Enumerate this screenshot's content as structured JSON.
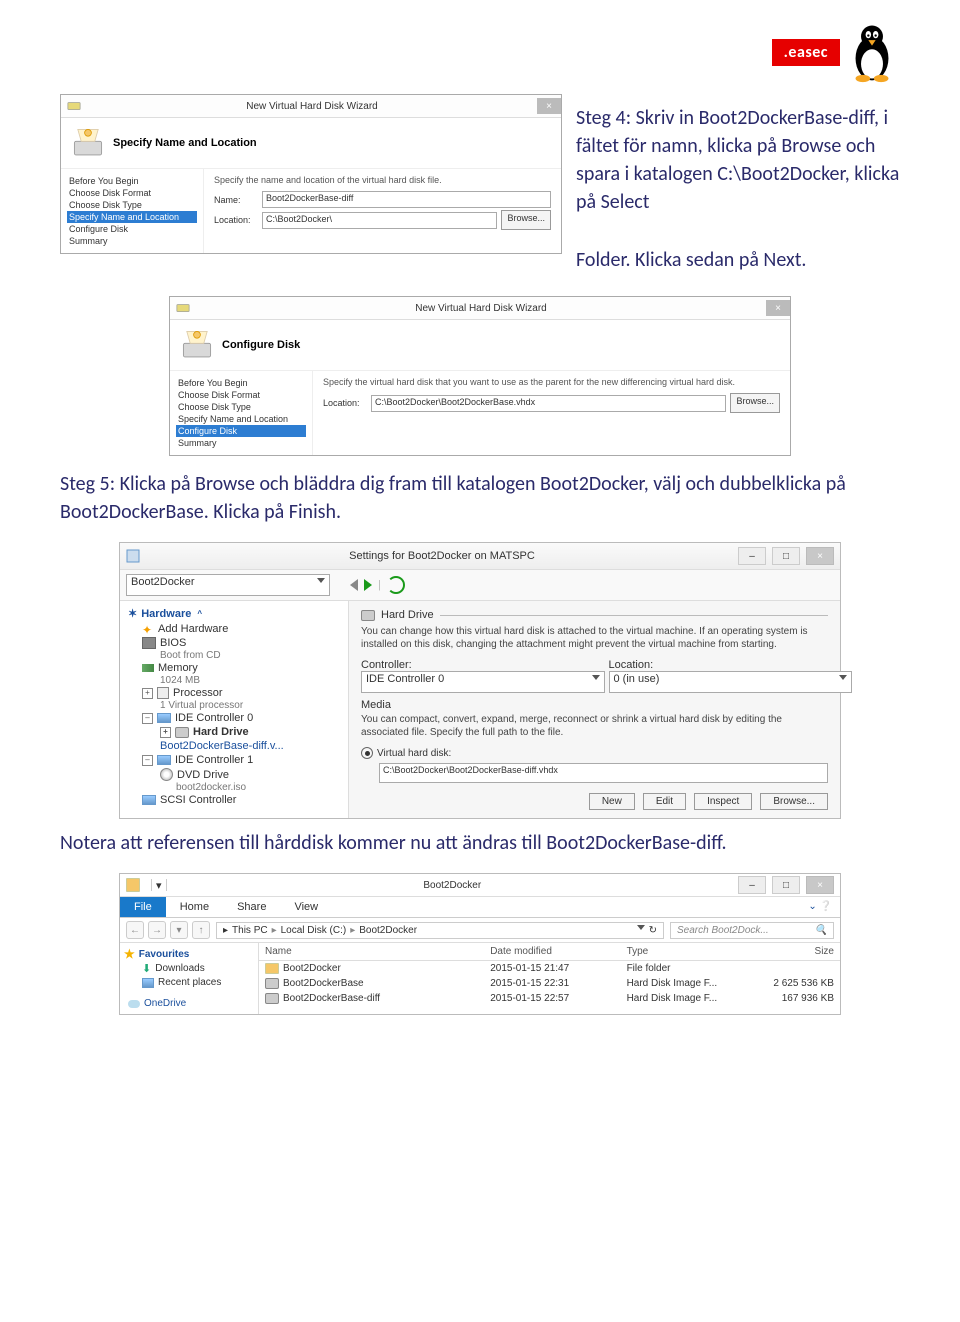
{
  "logo": {
    "brand": ".easec"
  },
  "para1": {
    "step_title": "Steg 4: Skriv in Boot2DockerBase-diff, i fältet för namn, klicka på Browse och spara i katalogen C:\\Boot2Docker, klicka på Select",
    "tail": "Folder. Klicka sedan på Next."
  },
  "wiz1": {
    "window_title": "New Virtual Hard Disk Wizard",
    "heading": "Specify Name and Location",
    "hint": "Specify the name and location of the virtual hard disk file.",
    "name_label": "Name:",
    "name_value": "Boot2DockerBase-diff",
    "loc_label": "Location:",
    "loc_value": "C:\\Boot2Docker\\",
    "browse": "Browse...",
    "steps": [
      "Before You Begin",
      "Choose Disk Format",
      "Choose Disk Type",
      "Specify Name and Location",
      "Configure Disk",
      "Summary"
    ],
    "selected_index": 3
  },
  "wiz2": {
    "window_title": "New Virtual Hard Disk Wizard",
    "heading": "Configure Disk",
    "hint": "Specify the virtual hard disk that you want to use as the parent for the new differencing virtual hard disk.",
    "loc_label": "Location:",
    "loc_value": "C:\\Boot2Docker\\Boot2DockerBase.vhdx",
    "browse": "Browse...",
    "steps": [
      "Before You Begin",
      "Choose Disk Format",
      "Choose Disk Type",
      "Specify Name and Location",
      "Configure Disk",
      "Summary"
    ],
    "selected_index": 4
  },
  "para2": "Steg 5: Klicka på Browse och bläddra dig fram till katalogen Boot2Docker, välj och dubbelklicka på Boot2DockerBase. Klicka på Finish.",
  "settings": {
    "title": "Settings for Boot2Docker on MATSPC",
    "combo": "Boot2Docker",
    "cat": "Hardware",
    "items": {
      "add_hw": "Add Hardware",
      "bios": "BIOS",
      "bios_sub": "Boot from CD",
      "memory": "Memory",
      "memory_sub": "1024 MB",
      "processor": "Processor",
      "processor_sub": "1 Virtual processor",
      "ide0": "IDE Controller 0",
      "hard_drive": "Hard Drive",
      "hd_file": "Boot2DockerBase-diff.v...",
      "ide1": "IDE Controller 1",
      "dvd": "DVD Drive",
      "dvd_file": "boot2docker.iso",
      "scsi": "SCSI Controller"
    },
    "main": {
      "group": "Hard Drive",
      "hint": "You can change how this virtual hard disk is attached to the virtual machine. If an operating system is installed on this disk, changing the attachment might prevent the virtual machine from starting.",
      "controller_label": "Controller:",
      "controller_value": "IDE Controller 0",
      "location_label": "Location:",
      "location_value": "0 (in use)",
      "media_label": "Media",
      "media_hint": "You can compact, convert, expand, merge, reconnect or shrink a virtual hard disk by editing the associated file. Specify the full path to the file.",
      "vhd_label": "Virtual hard disk:",
      "vhd_path": "C:\\Boot2Docker\\Boot2DockerBase-diff.vhdx",
      "buttons": [
        "New",
        "Edit",
        "Inspect",
        "Browse..."
      ]
    }
  },
  "para3": "Notera att referensen till hårddisk kommer nu att ändras till Boot2DockerBase-diff.",
  "explorer": {
    "title": "Boot2Docker",
    "ribbon": {
      "file": "File",
      "home": "Home",
      "share": "Share",
      "view": "View"
    },
    "breadcrumb": [
      "This PC",
      "Local Disk (C:)",
      "Boot2Docker"
    ],
    "search_placeholder": "Search Boot2Dock...",
    "nav": {
      "favourites": "Favourites",
      "downloads": "Downloads",
      "recent": "Recent places",
      "onedrive": "OneDrive"
    },
    "cols": {
      "name": "Name",
      "date": "Date modified",
      "type": "Type",
      "size": "Size"
    },
    "rows": [
      {
        "name": "Boot2Docker",
        "date": "2015-01-15 21:47",
        "type": "File folder",
        "size": ""
      },
      {
        "name": "Boot2DockerBase",
        "date": "2015-01-15 22:31",
        "type": "Hard Disk Image F...",
        "size": "2 625 536 KB"
      },
      {
        "name": "Boot2DockerBase-diff",
        "date": "2015-01-15 22:57",
        "type": "Hard Disk Image F...",
        "size": "167 936 KB"
      }
    ]
  }
}
